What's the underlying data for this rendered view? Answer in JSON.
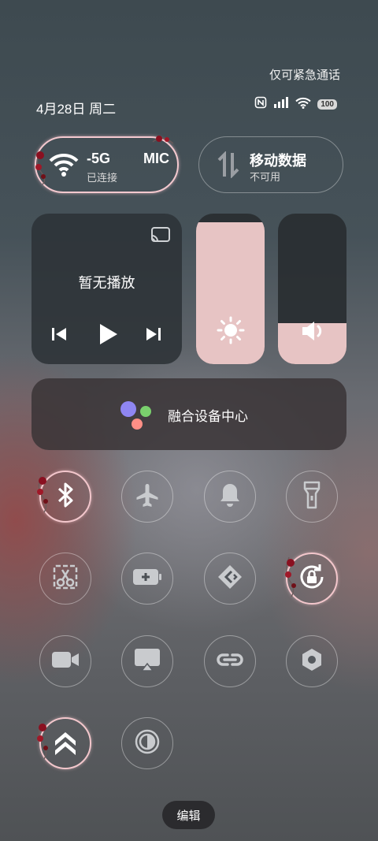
{
  "status": {
    "emergency_text": "仅可紧急通话",
    "date_text": "4月28日 周二",
    "battery_level": "100"
  },
  "wifi_tile": {
    "network_name": "-5G",
    "network_name_right": "MIC",
    "status": "已连接"
  },
  "data_tile": {
    "title": "移动数据",
    "status": "不可用"
  },
  "media": {
    "status": "暂无播放"
  },
  "brightness": {
    "level": 0.94
  },
  "volume": {
    "level": 0.27
  },
  "device_center": {
    "label": "融合设备中心"
  },
  "toggles": [
    {
      "name": "bluetooth-icon",
      "on": true
    },
    {
      "name": "airplane-icon",
      "on": false
    },
    {
      "name": "bell-icon",
      "on": false
    },
    {
      "name": "flashlight-icon",
      "on": false
    },
    {
      "name": "screenshot-icon",
      "on": false
    },
    {
      "name": "battery-saver-icon",
      "on": false
    },
    {
      "name": "cast-icon",
      "on": false
    },
    {
      "name": "rotation-lock-icon",
      "on": true
    },
    {
      "name": "screen-record-icon",
      "on": false
    },
    {
      "name": "screen-mirror-icon",
      "on": false
    },
    {
      "name": "link-icon",
      "on": false
    },
    {
      "name": "nfc-hex-icon",
      "on": false
    },
    {
      "name": "performance-icon",
      "on": true
    },
    {
      "name": "eye-comfort-icon",
      "on": false
    }
  ],
  "edit_label": "编辑",
  "colors": {
    "accent_pink": "#f3c7cc",
    "slider_fill": "#e7c4c4"
  }
}
